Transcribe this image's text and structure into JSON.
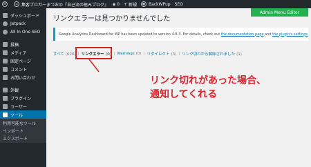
{
  "adminbar": {
    "site_name": "集客ブロガーまつおの『自己流の極みブログ』",
    "comments_count": "0",
    "new_label": "新規",
    "plugin1": "BackWPup",
    "plugin2": "SEO"
  },
  "sidebar": {
    "items": [
      {
        "label": "ダッシュボード",
        "icon": "dashboard-icon"
      },
      {
        "label": "Jetpack",
        "icon": "jetpack-icon"
      },
      {
        "label": "All In One SEO",
        "icon": "seo-icon"
      },
      {
        "label": "投稿",
        "icon": "pin-icon"
      },
      {
        "label": "メディア",
        "icon": "media-icon"
      },
      {
        "label": "固定ページ",
        "icon": "page-icon"
      },
      {
        "label": "コメント",
        "icon": "comment-icon"
      },
      {
        "label": "お問い合わせ",
        "icon": "mail-icon"
      },
      {
        "label": "外観",
        "icon": "brush-icon"
      },
      {
        "label": "プラグイン",
        "icon": "plugin-icon"
      },
      {
        "label": "ユーザー",
        "icon": "user-icon"
      },
      {
        "label": "ツール",
        "icon": "wrench-icon"
      }
    ],
    "submenu": [
      "利用可能なツール",
      "インポート",
      "エクスポート"
    ]
  },
  "main": {
    "title": "リンクエラーは見つかりませんでした",
    "admin_menu_button": "Admin Menu Editor",
    "notice_text": "Google Analytics Dashboard for WP has been updated to version 4.8.3. For details, check out",
    "notice_link1": "the documentation page",
    "notice_and": "and",
    "notice_link2": "the plugin's settings",
    "filters": [
      {
        "label": "すべて",
        "count": "(626)"
      },
      {
        "label": "リンクエラー",
        "count": "(0)"
      },
      {
        "label": "Warnings",
        "count": "(0)"
      },
      {
        "label": "リダイレクト",
        "count": "(3)"
      },
      {
        "label": "リンク切れから解除されました",
        "count": "(1)"
      }
    ],
    "annotation_line1": "リンク切れがあった場合、",
    "annotation_line2": "通知してくれる"
  },
  "colors": {
    "sidebar_bg": "#23282d",
    "current_menu": "#0073aa",
    "admin_menu_btn": "#22b14c",
    "annotation_red": "#e8202a"
  }
}
